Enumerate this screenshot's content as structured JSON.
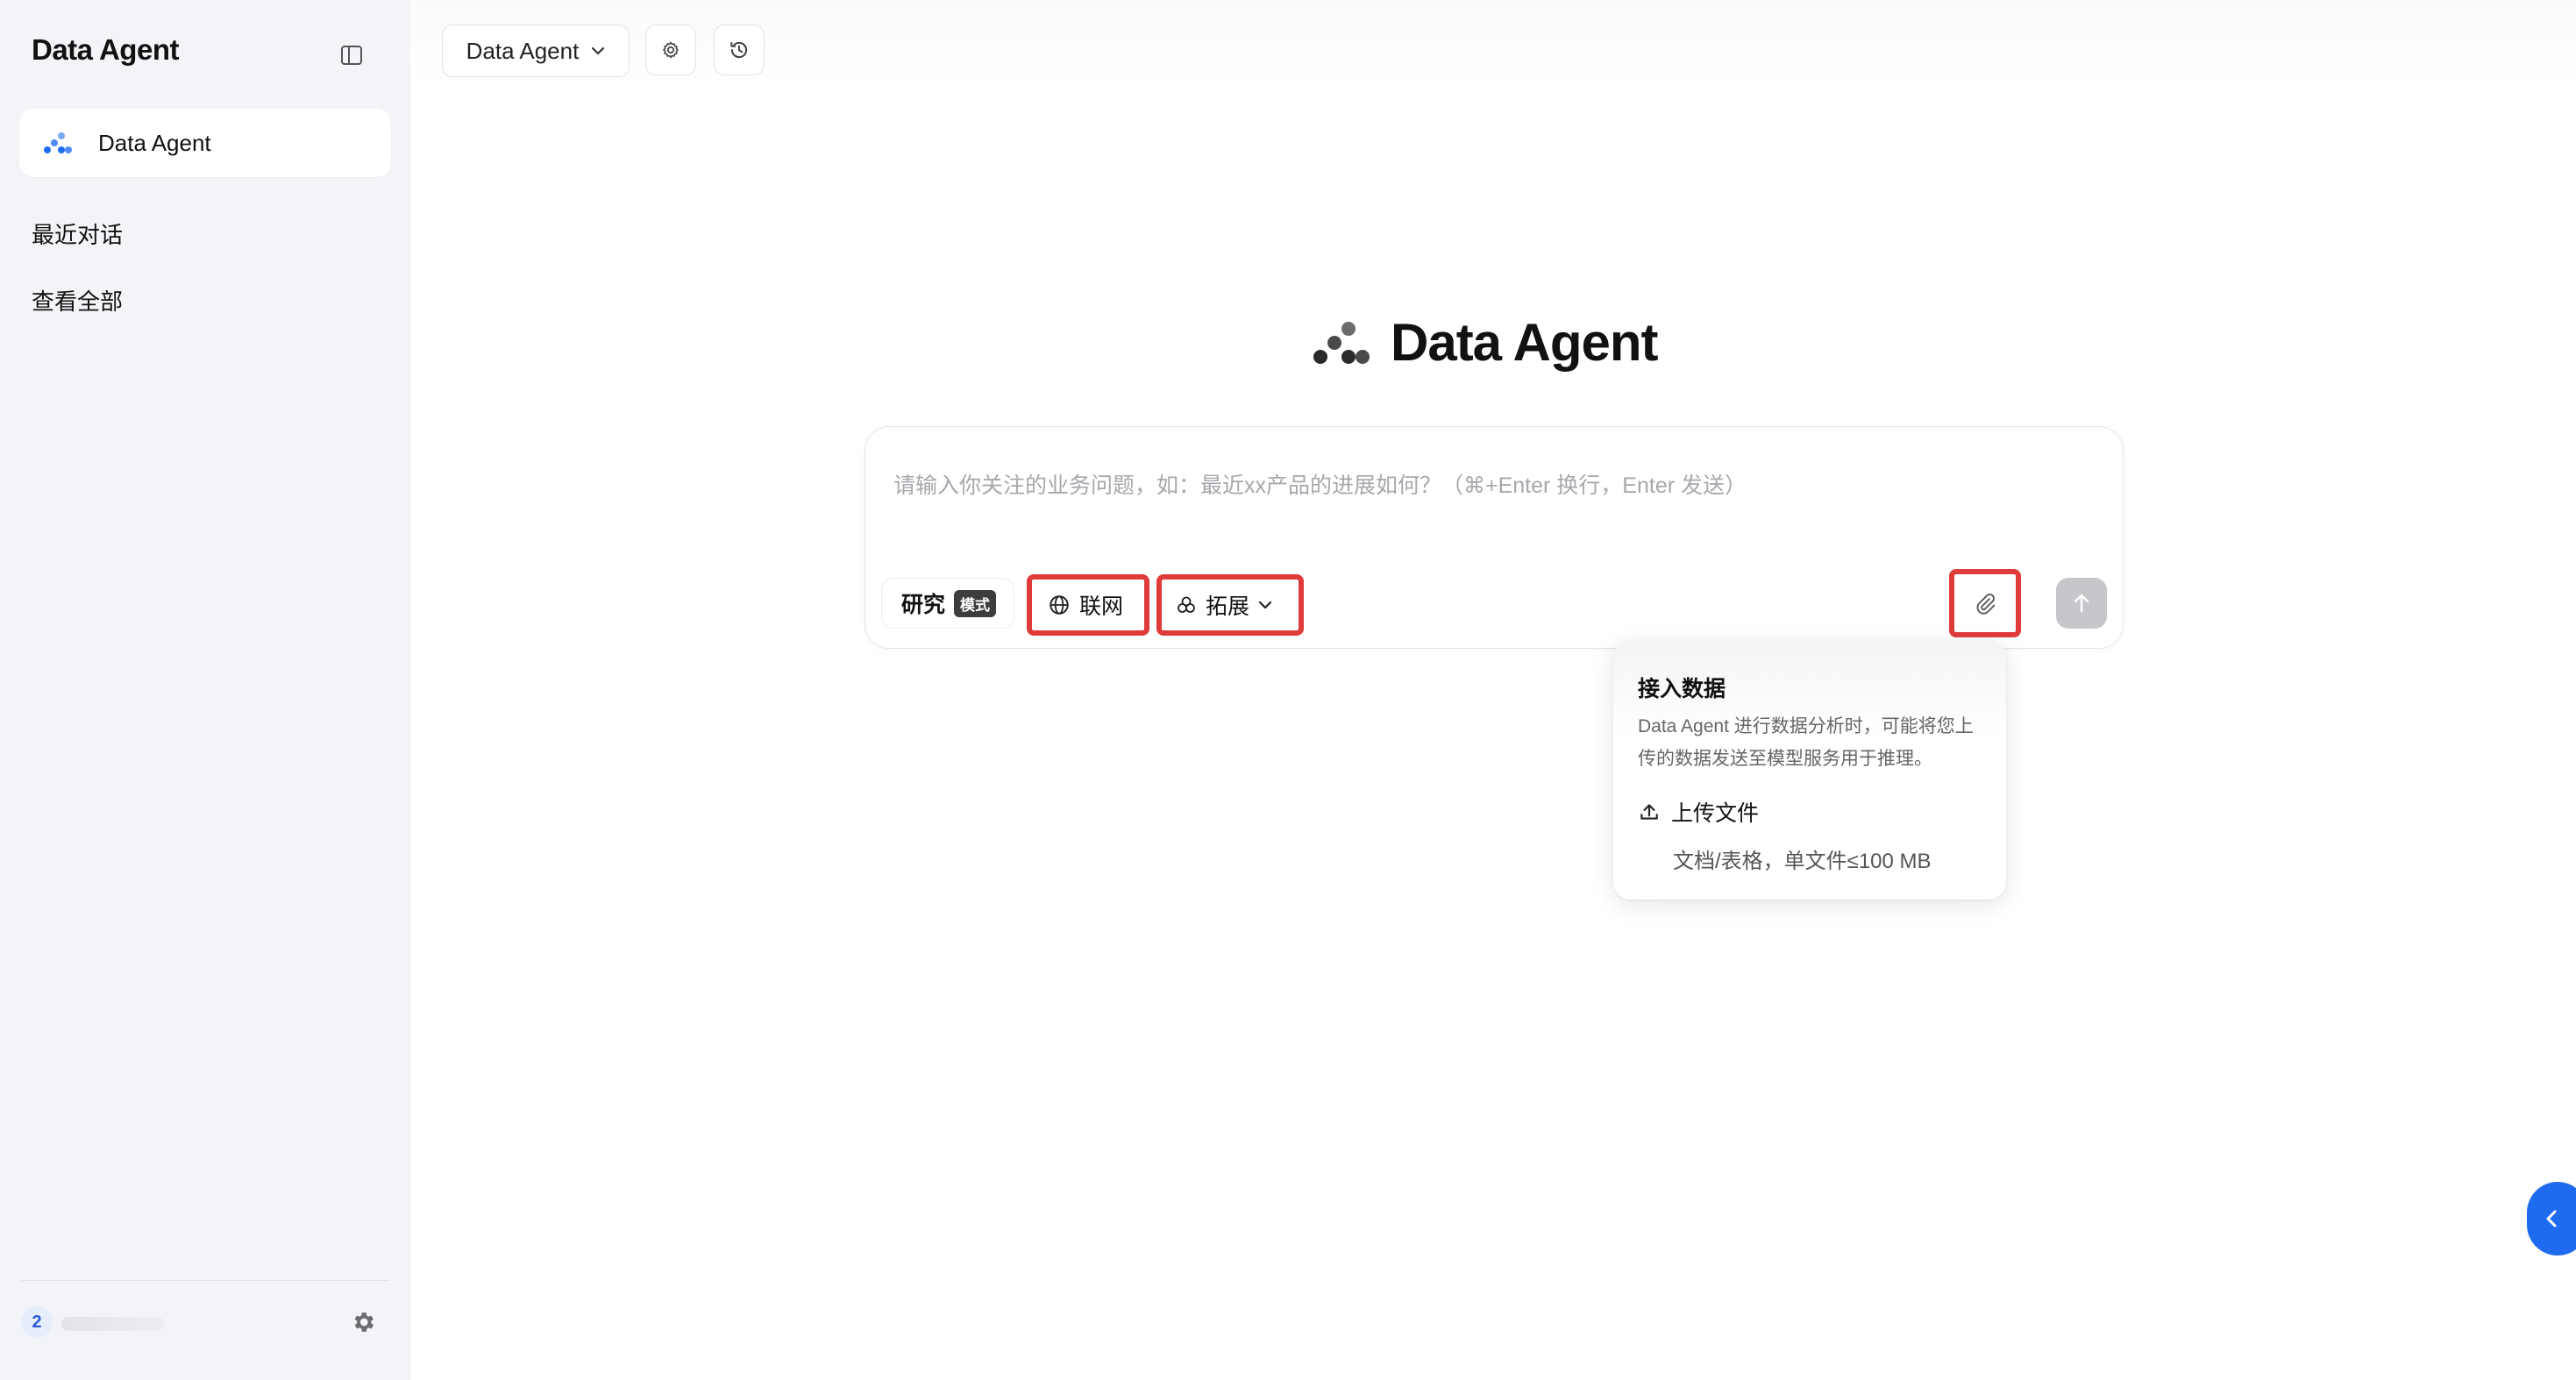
{
  "sidebar": {
    "app_title": "Data Agent",
    "active_item": {
      "label": "Data Agent",
      "icon": "data-agent-logo"
    },
    "links": [
      {
        "label": "最近对话"
      },
      {
        "label": "查看全部"
      }
    ],
    "user": {
      "badge": "2"
    }
  },
  "topbar": {
    "agent_select_label": "Data Agent",
    "settings_icon": "gear-icon",
    "history_icon": "history-icon"
  },
  "hero": {
    "title": "Data Agent"
  },
  "composer": {
    "placeholder": "请输入你关注的业务问题，如：最近xx产品的进展如何？（⌘+Enter 换行，Enter 发送）",
    "value": "",
    "research_label": "研究",
    "mode_badge": "模式",
    "web_label": "联网",
    "extend_label": "拓展"
  },
  "popover": {
    "title": "接入数据",
    "description": "Data Agent 进行数据分析时，可能将您上传的数据发送至模型服务用于推理。",
    "upload_label": "上传文件",
    "upload_hint": "文档/表格，单文件≤100 MB"
  },
  "colors": {
    "accent": "#1f6bf0",
    "highlight_border": "#e03b3b",
    "sidebar_bg": "#f3f4f7"
  }
}
